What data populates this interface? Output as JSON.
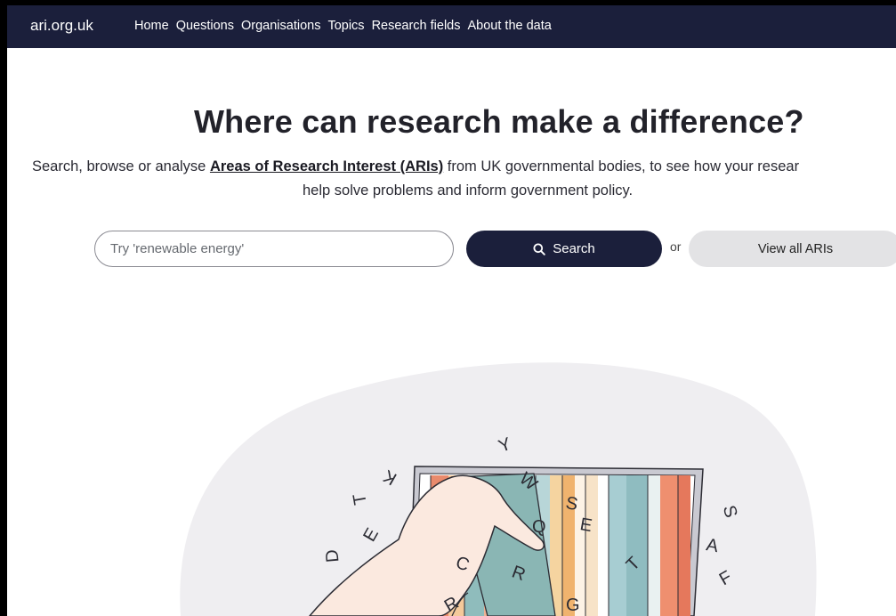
{
  "nav": {
    "brand": "ari.org.uk",
    "links": [
      "Home",
      "Questions",
      "Organisations",
      "Topics",
      "Research fields",
      "About the data"
    ]
  },
  "hero": {
    "title": "Where can research make a difference?",
    "subtitle_before": "Search, browse or analyse ",
    "subtitle_link": "Areas of Research Interest (ARIs)",
    "subtitle_after": " from UK governmental bodies, to see how your resear",
    "subtitle_line2": "help solve problems and inform government policy."
  },
  "search": {
    "placeholder": "Try 'renewable energy'",
    "button_label": "Search",
    "or_label": "or",
    "view_all_label": "View all ARIs"
  },
  "colors": {
    "nav_bg": "#1b1f3b",
    "button_primary": "#1b1f3b",
    "button_secondary": "#e3e3e5",
    "blob": "#efeef1"
  },
  "illustration": {
    "icons": [
      "laptop-icon",
      "hand-icon"
    ],
    "letters": [
      "Y",
      "K",
      "T",
      "W",
      "S",
      "E",
      "Q",
      "D",
      "E",
      "C",
      "R",
      "A",
      "R",
      "G",
      "T",
      "F"
    ]
  }
}
